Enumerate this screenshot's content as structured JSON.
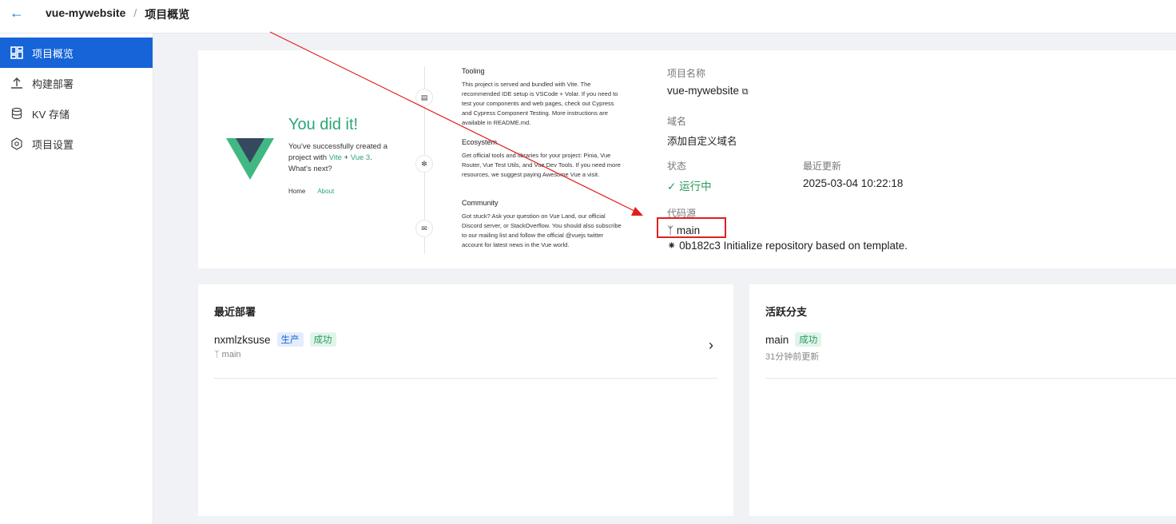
{
  "topbar": {
    "back_icon": "arrow-left-icon",
    "project": "vue-mywebsite",
    "separator": "/",
    "page": "项目概览"
  },
  "sidebar": {
    "items": [
      {
        "label": "项目概览",
        "icon": "dashboard-icon",
        "active": true
      },
      {
        "label": "构建部署",
        "icon": "upload-icon"
      },
      {
        "label": "KV 存储",
        "icon": "database-icon"
      },
      {
        "label": "项目设置",
        "icon": "settings-icon"
      }
    ]
  },
  "preview": {
    "title": "You did it!",
    "sub1": "You've successfully created a project with ",
    "vite": "Vite",
    "plus": " + ",
    "vue3": "Vue 3",
    "sub2": ". What's next?",
    "home": "Home",
    "about": "About",
    "tooling_title": "Tooling",
    "tooling_body": "This project is served and bundled with Vite. The recommended IDE setup is VSCode + Volar. If you need to test your components and web pages, check out Cypress and Cypress Component Testing. More instructions are available in README.md.",
    "ecosystem_title": "Ecosystem",
    "ecosystem_body": "Get official tools and libraries for your project: Pinia, Vue Router, Vue Test Utils, and Vue Dev Tools. If you need more resources, we suggest paying Awesome Vue a visit.",
    "community_title": "Community",
    "community_body": "Got stuck? Ask your question on Vue Land, our official Discord server, or StackOverflow. You should also subscribe to our mailing list and follow the official @vuejs twitter account for latest news in the Vue world."
  },
  "info": {
    "name_label": "项目名称",
    "name_value": "vue-mywebsite",
    "domain_label": "域名",
    "domain_link": "添加自定义域名",
    "status_label": "状态",
    "status_value": "运行中",
    "updated_label": "最近更新",
    "updated_value": "2025-03-04 10:22:18",
    "source_label": "代码源",
    "branch": "main",
    "commit": "0b182c3 Initialize repository based on template."
  },
  "recent_deploy": {
    "title": "最近部署",
    "name": "nxmlzksuse",
    "tag_env": "生产",
    "tag_status": "成功",
    "branch": "main"
  },
  "active_branch": {
    "title": "活跃分支",
    "name": "main",
    "tag_status": "成功",
    "updated": "31分钟前更新"
  },
  "colors": {
    "accent": "#1664d8",
    "vue_green": "#2aa776",
    "annotation_red": "#e02020"
  }
}
